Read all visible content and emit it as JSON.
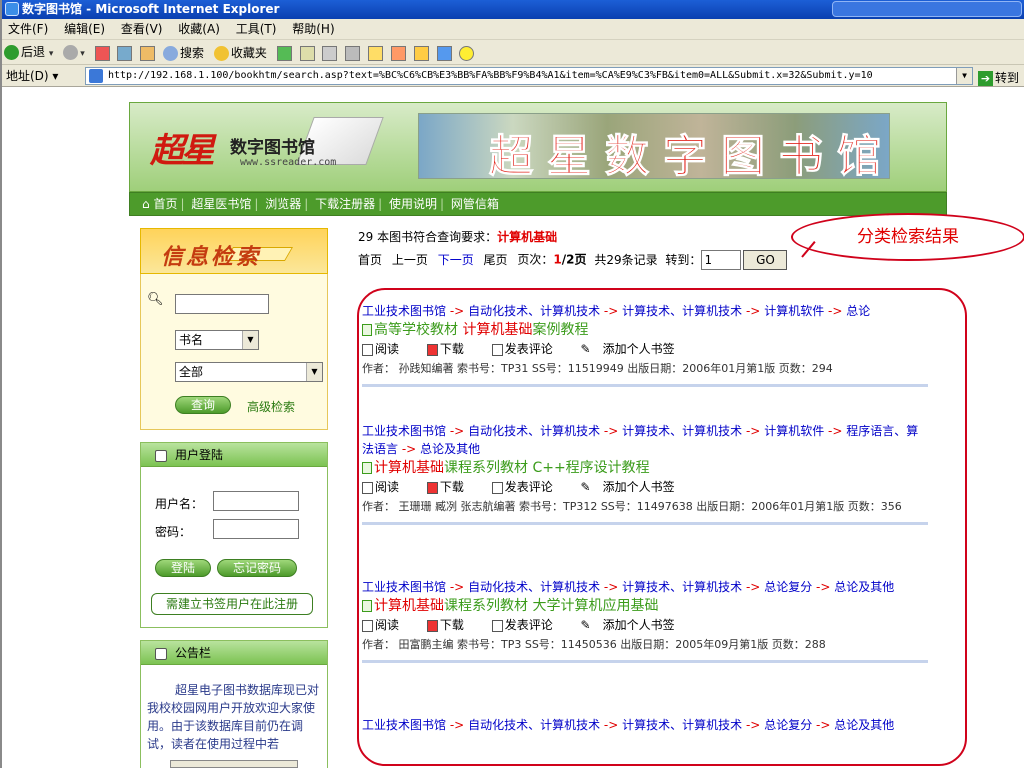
{
  "window": {
    "title": "数字图书馆 - Microsoft Internet Explorer"
  },
  "menu": [
    "文件(F)",
    "编辑(E)",
    "查看(V)",
    "收藏(A)",
    "工具(T)",
    "帮助(H)"
  ],
  "toolbar": {
    "back": "后退",
    "search": "搜索",
    "favorites": "收藏夹"
  },
  "address": {
    "label": "地址(D)",
    "url": "http://192.168.1.100/bookhtm/search.asp?text=%BC%C6%CB%E3%BB%FA%BB%F9%B4%A1&item=%CA%E9%C3%FB&item0=ALL&Submit.x=32&Submit.y=10",
    "go": "转到"
  },
  "site": {
    "logo_big": "超星",
    "logo_text": "数字图书馆",
    "logo_url": "www.ssreader.com",
    "banner_text": "超星数字图书馆",
    "nav": [
      "首页",
      "超星医书馆",
      "浏览器",
      "下载注册器",
      "使用说明",
      "网管信箱"
    ],
    "search": {
      "title": "信息检索",
      "field": "书名",
      "scope": "全部",
      "submit": "查询",
      "advanced": "高级检索"
    },
    "login": {
      "title": "用户登陆",
      "user_label": "用户名：",
      "pass_label": "密码：",
      "login_btn": "登陆",
      "forgot_btn": "忘记密码",
      "register": "需建立书签用户在此注册"
    },
    "notice": {
      "title": "公告栏",
      "text": "超星电子图书数据库现已对我校校园网用户开放欢迎大家使用。由于该数据库目前仍在调试，读者在使用过程中若"
    }
  },
  "results": {
    "summary_prefix": "29 本图书符合查询要求：",
    "query": "计算机基础",
    "pager": {
      "first": "首页",
      "prev": "上一页",
      "next": "下一页",
      "last": "尾页",
      "page_label": "页次：",
      "page_cur": "1",
      "page_tot": "/2页",
      "total": "共29条记录",
      "goto": "转到：",
      "goto_value": "1",
      "go_btn": "GO"
    },
    "records": [
      {
        "path": [
          "工业技术图书馆",
          "自动化技术、计算机技术",
          "计算技术、计算机技术",
          "计算机软件",
          "总论"
        ],
        "title_prefix": "高等学校教材 ",
        "title_hl": "计算机基础",
        "title_suffix": "案例教程",
        "meta": "作者： 孙践知编著 索书号：TP31  SS号：11519949   出版日期：2006年01月第1版  页数：294"
      },
      {
        "path": [
          "工业技术图书馆",
          "自动化技术、计算机技术",
          "计算技术、计算机技术",
          "计算机软件",
          "程序语言、算法语言",
          "总论及其他"
        ],
        "title_prefix": "",
        "title_hl": "计算机基础",
        "title_suffix": "课程系列教材 C++程序设计教程",
        "meta": "作者： 王珊珊 臧冽 张志航编著 索书号：TP312  SS号：11497638   出版日期：2006年01月第1版  页数：356"
      },
      {
        "path": [
          "工业技术图书馆",
          "自动化技术、计算机技术",
          "计算技术、计算机技术",
          "总论复分",
          "总论及其他"
        ],
        "title_prefix": "",
        "title_hl": "计算机基础",
        "title_suffix": "课程系列教材 大学计算机应用基础",
        "meta": "作者： 田富鹏主编 索书号：TP3  SS号：11450536   出版日期：2005年09月第1版  页数：288"
      },
      {
        "path": [
          "工业技术图书馆",
          "自动化技术、计算机技术",
          "计算技术、计算机技术",
          "总论复分",
          "总论及其他"
        ],
        "title_prefix": "",
        "title_hl": "",
        "title_suffix": "",
        "meta": ""
      }
    ],
    "actions": [
      "阅读",
      "下载",
      "发表评论",
      "添加个人书签"
    ]
  },
  "annotation": {
    "label": "分类检索结果",
    "color": "#d0021b"
  }
}
